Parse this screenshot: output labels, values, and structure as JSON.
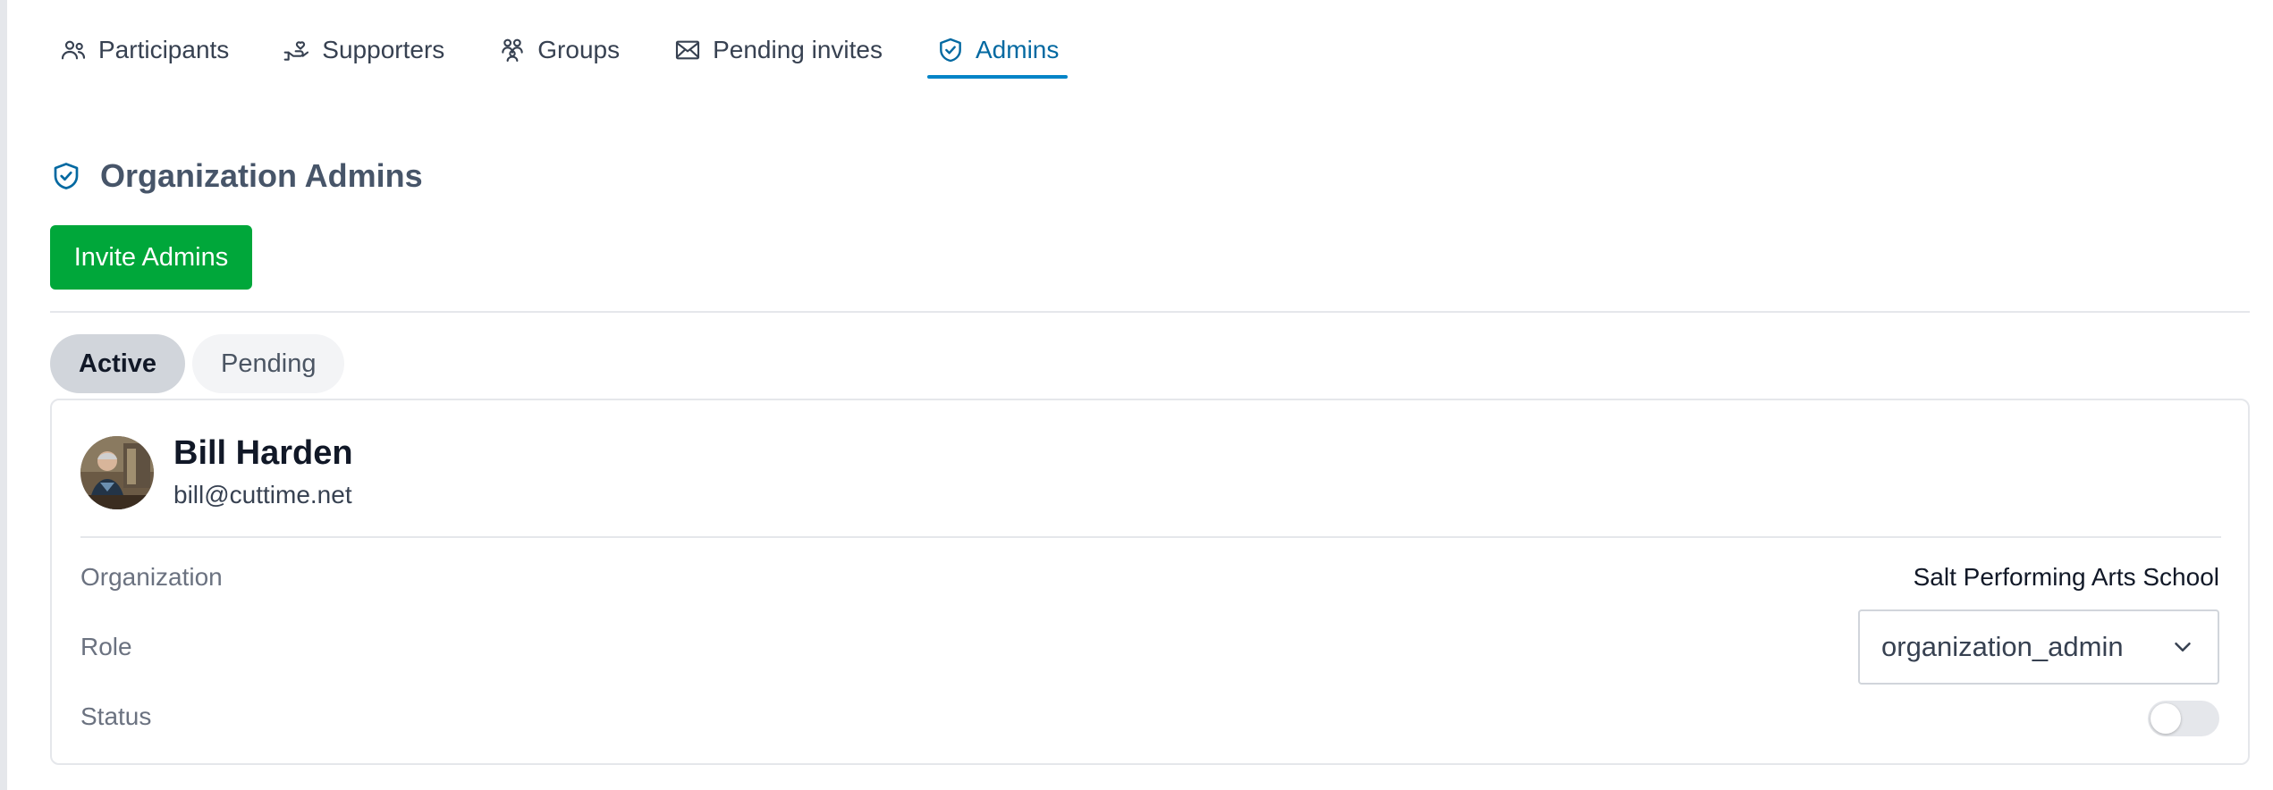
{
  "tabs": [
    {
      "label": "Participants",
      "icon": "users-icon",
      "active": false
    },
    {
      "label": "Supporters",
      "icon": "hand-heart-icon",
      "active": false
    },
    {
      "label": "Groups",
      "icon": "group-icon",
      "active": false
    },
    {
      "label": "Pending invites",
      "icon": "mail-icon",
      "active": false
    },
    {
      "label": "Admins",
      "icon": "shield-check-icon",
      "active": true
    }
  ],
  "section": {
    "title": "Organization Admins",
    "icon": "shield-check-icon",
    "invite_button": "Invite Admins"
  },
  "filters": {
    "active_label": "Active",
    "pending_label": "Pending",
    "selected": "Active"
  },
  "admins": [
    {
      "name": "Bill Harden",
      "email": "bill@cuttime.net",
      "organization_label": "Organization",
      "organization": "Salt Performing Arts School",
      "role_label": "Role",
      "role": "organization_admin",
      "status_label": "Status",
      "status_on": false
    }
  ],
  "colors": {
    "accent": "#0284c7",
    "primary_button": "#00a73a",
    "text_muted": "#6b7280"
  }
}
